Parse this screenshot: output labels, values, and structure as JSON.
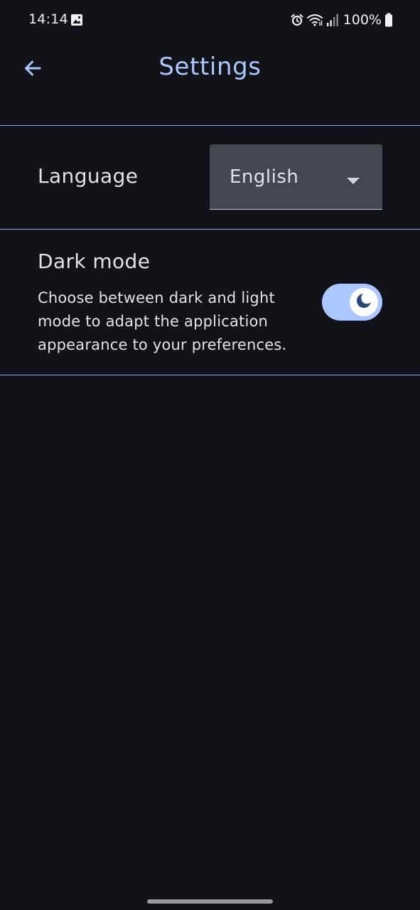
{
  "status_bar": {
    "time": "14:14",
    "battery": "100%",
    "icons": [
      "gallery-icon",
      "alarm-icon",
      "wifi-icon",
      "signal-icon",
      "battery-icon"
    ]
  },
  "app_bar": {
    "title": "Settings",
    "back_icon": "arrow-back-icon"
  },
  "settings": {
    "language": {
      "label": "Language",
      "selected": "English",
      "dropdown_icon": "arrow-drop-down-icon"
    },
    "dark_mode": {
      "title": "Dark mode",
      "description": "Choose between dark and light mode to adapt the application appearance to your preferences.",
      "enabled": true,
      "thumb_icon": "moon-icon"
    }
  },
  "colors": {
    "background": "#121318",
    "accent": "#aac7ff",
    "on_surface": "#e3e2e9",
    "select_container": "#434750",
    "moon": "#2a4678"
  }
}
